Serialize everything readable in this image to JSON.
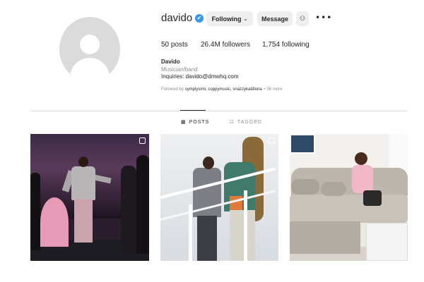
{
  "profile": {
    "username": "davido",
    "verified_mark": "✔",
    "buttons": {
      "following": "Following",
      "following_chevron": "⌄",
      "message": "Message",
      "suggest_icon": "⚇"
    },
    "more_icon": "•••",
    "stats": {
      "posts": "50 posts",
      "followers": "26.4M followers",
      "following": "1,754 following"
    },
    "full_name": "Davido",
    "category": "Musician/band",
    "bio": "Inquiries: davido@dmwhq.com",
    "followed_by_prefix": "Followed by ",
    "followed_by_names": "symplysimi, cuppymusic, snazzykatdluna",
    "followed_by_more": " + 36 more"
  },
  "tabs": {
    "posts": {
      "label": "POSTS",
      "icon": "▦"
    },
    "tagged": {
      "label": "TAGGED",
      "icon": "⊡"
    }
  },
  "posts": [
    {
      "multi": true
    },
    {
      "multi": true
    },
    {
      "multi": true
    }
  ],
  "colors": {
    "verified": "#3897f0",
    "button_bg": "#efefef",
    "muted_text": "#8e8e8e",
    "divider": "#dbdbdb"
  }
}
